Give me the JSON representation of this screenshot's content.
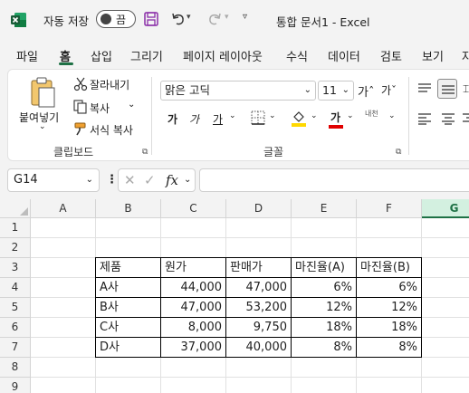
{
  "titlebar": {
    "autosave_label": "자동 저장",
    "autosave_state": "끔",
    "document_title": "통합 문서1  -  Excel"
  },
  "tabs": [
    "파일",
    "홈",
    "삽입",
    "그리기",
    "페이지 레이아웃",
    "수식",
    "데이터",
    "검토",
    "보기",
    "자"
  ],
  "ribbon": {
    "paste_label": "붙여넣기",
    "cut_label": "잘라내기",
    "copy_label": "복사",
    "format_painter_label": "서식 복사",
    "clipboard_group": "클립보드",
    "font_name": "맑은 고딕",
    "font_size": "11",
    "grow_font": "가ˆ",
    "shrink_font": "가ˇ",
    "bold": "가",
    "italic": "가",
    "underline": "가",
    "font_color_glyph": "가",
    "phonetic": "내천",
    "font_group": "글꼴",
    "accent_color": "#1e7145",
    "fill_color": "#ffd800",
    "font_color": "#e00000"
  },
  "formula_bar": {
    "name_box": "G14",
    "fx": "fx",
    "formula": ""
  },
  "sheet": {
    "columns": [
      "A",
      "B",
      "C",
      "D",
      "E",
      "F",
      "G"
    ],
    "rows": [
      "1",
      "2",
      "3",
      "4",
      "5",
      "6",
      "7",
      "8",
      "9"
    ],
    "selected_column": "G",
    "table_header": [
      "제품",
      "원가",
      "판매가",
      "마진율(A)",
      "마진율(B)"
    ],
    "table_rows": [
      [
        "A사",
        "44,000",
        "47,000",
        "6%",
        "6%"
      ],
      [
        "B사",
        "47,000",
        "53,200",
        "12%",
        "12%"
      ],
      [
        "C사",
        "8,000",
        "9,750",
        "18%",
        "18%"
      ],
      [
        "D사",
        "37,000",
        "40,000",
        "8%",
        "8%"
      ]
    ]
  }
}
